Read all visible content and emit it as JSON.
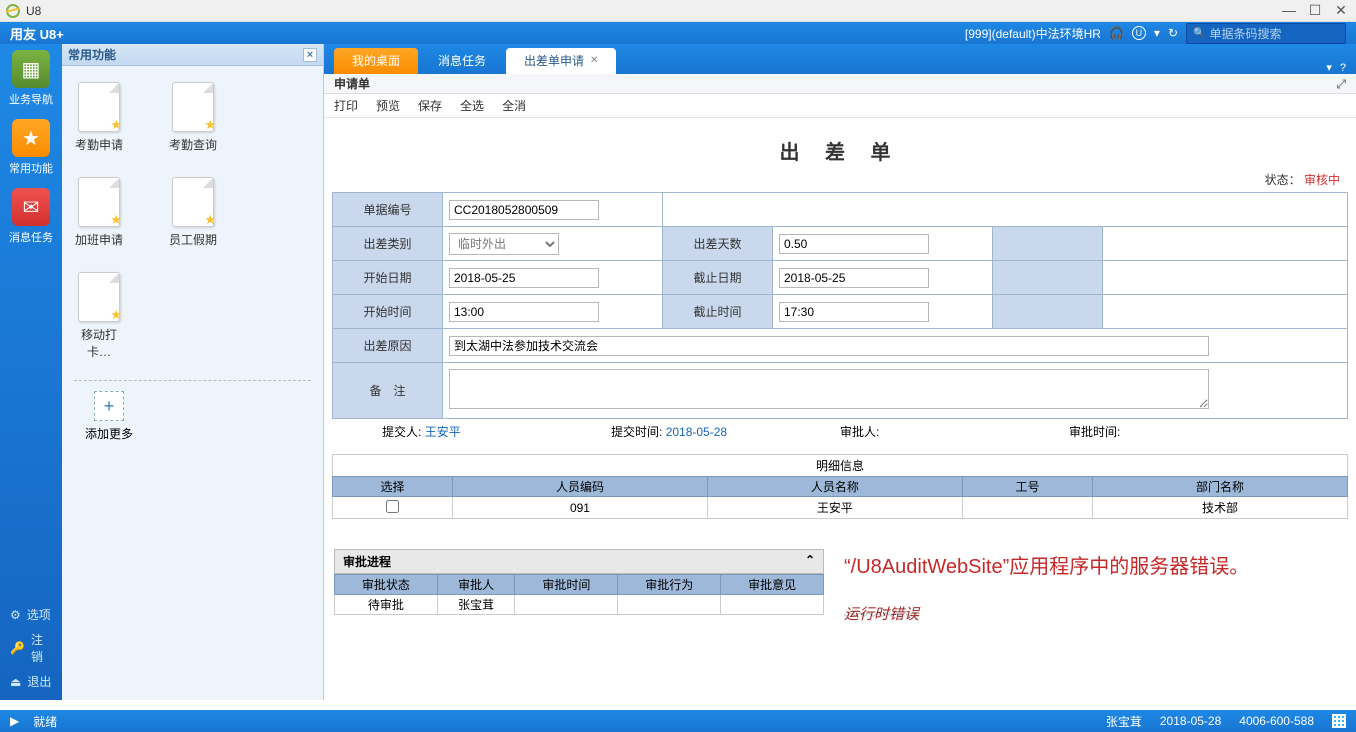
{
  "window": {
    "title": "U8"
  },
  "topbar": {
    "brand": "用友 U8+",
    "org": "[999](default)中法环境HR",
    "search_placeholder": "单据条码搜索"
  },
  "leftnav": {
    "items": [
      {
        "label": "业务导航"
      },
      {
        "label": "常用功能"
      },
      {
        "label": "消息任务"
      }
    ],
    "bottom": [
      {
        "label": "选项"
      },
      {
        "label": "注销"
      },
      {
        "label": "退出"
      }
    ]
  },
  "sidebar": {
    "title": "常用功能",
    "apps": [
      {
        "label": "考勤申请"
      },
      {
        "label": "考勤查询"
      },
      {
        "label": "加班申请"
      },
      {
        "label": "员工假期"
      },
      {
        "label": "移动打卡…"
      }
    ],
    "add_more": "添加更多"
  },
  "tabs": [
    {
      "label": "我的桌面",
      "kind": "orange"
    },
    {
      "label": "消息任务",
      "kind": "plain"
    },
    {
      "label": "出差单申请",
      "kind": "active"
    }
  ],
  "doc": {
    "subtitle": "申请单",
    "toolbar": [
      "打印",
      "预览",
      "保存",
      "全选",
      "全消"
    ],
    "form_title": "出 差 单",
    "status_label": "状态：",
    "status_value": "审核中",
    "fields": {
      "doc_no_label": "单据编号",
      "doc_no": "CC2018052800509",
      "trip_type_label": "出差类别",
      "trip_type": "临时外出",
      "trip_days_label": "出差天数",
      "trip_days": "0.50",
      "start_date_label": "开始日期",
      "start_date": "2018-05-25",
      "end_date_label": "截止日期",
      "end_date": "2018-05-25",
      "start_time_label": "开始时间",
      "start_time": "13:00",
      "end_time_label": "截止时间",
      "end_time": "17:30",
      "reason_label": "出差原因",
      "reason": "到太湖中法参加技术交流会",
      "remark_label": "备　注",
      "remark": ""
    },
    "submit_line": {
      "submitter_label": "提交人:",
      "submitter": "王安平",
      "submit_time_label": "提交时间:",
      "submit_time": "2018-05-28",
      "approver_label": "审批人:",
      "approver": "",
      "approve_time_label": "审批时间:",
      "approve_time": ""
    },
    "detail": {
      "title": "明细信息",
      "columns": [
        "选择",
        "人员编码",
        "人员名称",
        "工号",
        "部门名称"
      ],
      "row": {
        "code": "091",
        "name": "王安平",
        "emp_no": "",
        "dept": "技术部"
      }
    },
    "approval": {
      "title": "审批进程",
      "columns": [
        "审批状态",
        "审批人",
        "审批时间",
        "审批行为",
        "审批意见"
      ],
      "row": {
        "status": "待审批",
        "person": "张宝茸",
        "time": "",
        "action": "",
        "opinion": ""
      }
    },
    "error": {
      "line1": "“/U8AuditWebSite”应用程序中的服务器错误。",
      "line2": "运行时错误"
    }
  },
  "statusbar": {
    "ready": "就绪",
    "user": "张宝茸",
    "date": "2018-05-28",
    "phone": "4006-600-588"
  }
}
